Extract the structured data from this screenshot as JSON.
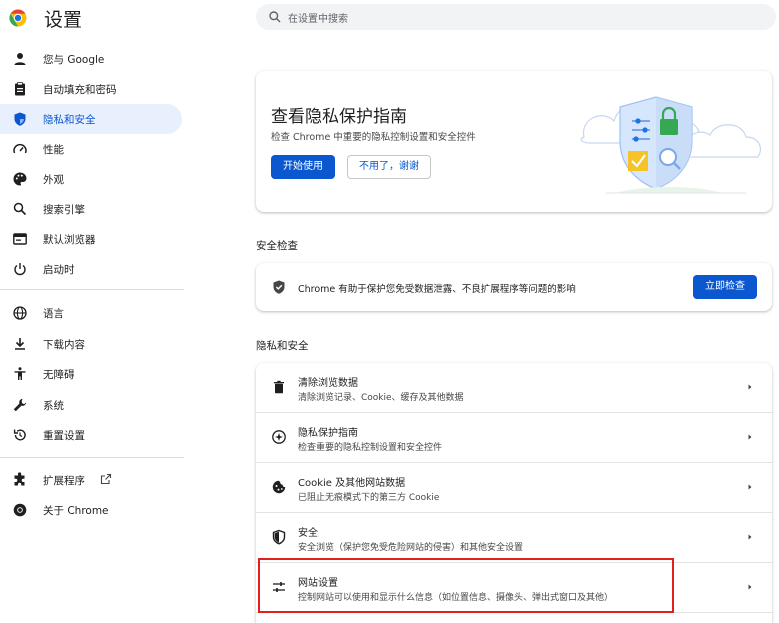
{
  "header": {
    "title": "设置",
    "search_placeholder": "在设置中搜索"
  },
  "sidebar": {
    "items": [
      {
        "label": "您与 Google",
        "icon": "person-icon"
      },
      {
        "label": "自动填充和密码",
        "icon": "clipboard-icon"
      },
      {
        "label": "隐私和安全",
        "icon": "shield-icon",
        "active": true
      },
      {
        "label": "性能",
        "icon": "speedometer-icon"
      },
      {
        "label": "外观",
        "icon": "palette-icon"
      },
      {
        "label": "搜索引擎",
        "icon": "search-icon"
      },
      {
        "label": "默认浏览器",
        "icon": "browser-window-icon"
      },
      {
        "label": "启动时",
        "icon": "power-icon"
      },
      {
        "label": "语言",
        "icon": "globe-icon"
      },
      {
        "label": "下载内容",
        "icon": "download-icon"
      },
      {
        "label": "无障碍",
        "icon": "accessibility-icon"
      },
      {
        "label": "系统",
        "icon": "wrench-icon"
      },
      {
        "label": "重置设置",
        "icon": "reset-icon"
      },
      {
        "label": "扩展程序",
        "icon": "puzzle-icon"
      },
      {
        "label": "关于 Chrome",
        "icon": "chrome-icon"
      }
    ]
  },
  "promo": {
    "title": "查看隐私保护指南",
    "description": "检查 Chrome 中重要的隐私控制设置和安全控件",
    "start_button": "开始使用",
    "dismiss_button": "不用了，谢谢"
  },
  "safety_check": {
    "section_title": "安全检查",
    "text": "Chrome 有助于保护您免受数据泄露、不良扩展程序等问题的影响",
    "button": "立即检查"
  },
  "privacy": {
    "section_title": "隐私和安全",
    "rows": [
      {
        "title": "清除浏览数据",
        "subtitle": "清除浏览记录、Cookie、缓存及其他数据",
        "icon": "trash-icon"
      },
      {
        "title": "隐私保护指南",
        "subtitle": "检查重要的隐私控制设置和安全控件",
        "icon": "compass-icon"
      },
      {
        "title": "Cookie 及其他网站数据",
        "subtitle": "已阻止无痕模式下的第三方 Cookie",
        "icon": "cookie-icon"
      },
      {
        "title": "安全",
        "subtitle": "安全浏览（保护您免受危险网站的侵害）和其他安全设置",
        "icon": "shield-icon"
      },
      {
        "title": "网站设置",
        "subtitle": "控制网站可以使用和显示什么信息（如位置信息、摄像头、弹出式窗口及其他）",
        "icon": "sliders-icon"
      }
    ]
  },
  "colors": {
    "accent": "#0b57d0",
    "active_bg": "#e8f0fe",
    "highlight_border": "#e0201c"
  }
}
